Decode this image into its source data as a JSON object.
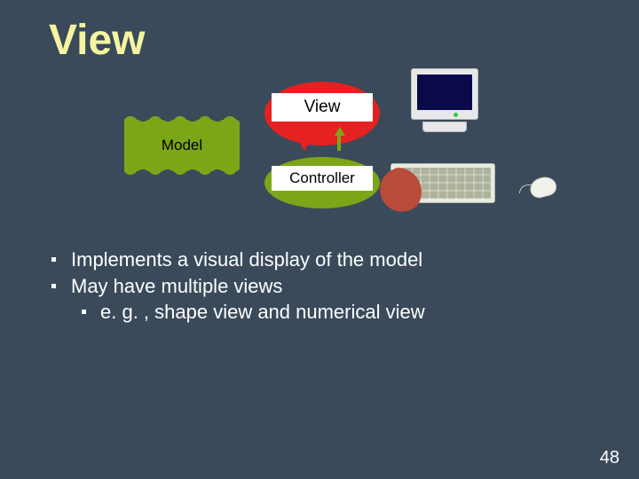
{
  "title": "View",
  "diagram": {
    "model_label": "Model",
    "view_label": "View",
    "controller_label": "Controller"
  },
  "bullets": [
    "Implements a visual display of the model",
    "May have multiple views"
  ],
  "sub_bullets": [
    "e. g. , shape view and numerical view"
  ],
  "page_number": "48"
}
